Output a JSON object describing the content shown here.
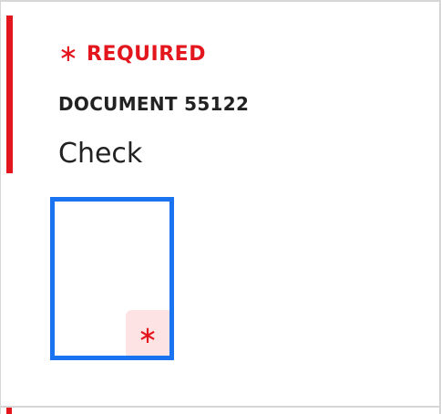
{
  "field": {
    "required_marker": "∗",
    "required_label": "REQUIRED",
    "document_id": "DOCUMENT 55122",
    "label": "Check",
    "checkbox_required_marker": "∗",
    "checked": false
  },
  "colors": {
    "required": "#e3161d",
    "focus_border": "#1a73f0",
    "badge_background": "#fde3e3",
    "text": "#222222",
    "frame": "#d6d6d6"
  },
  "icons": {
    "required_indicator": "asterisk-icon"
  }
}
